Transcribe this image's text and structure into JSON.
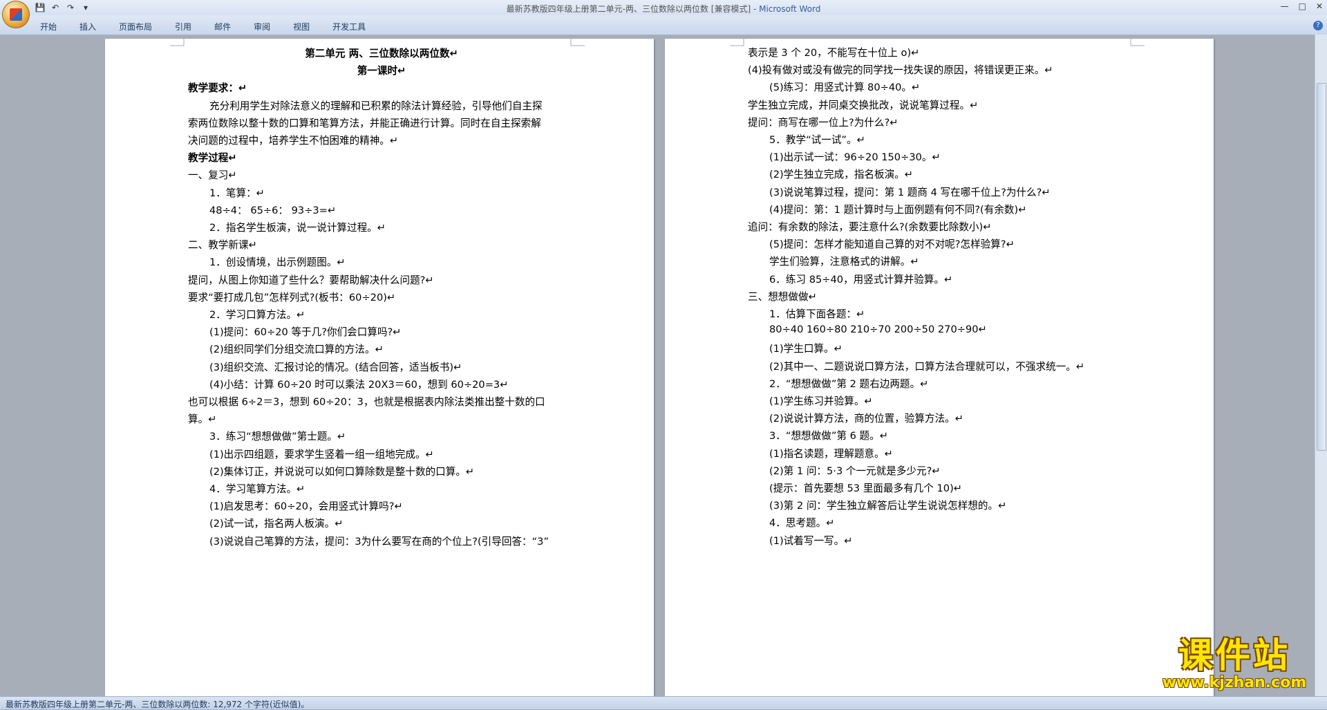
{
  "window": {
    "title": "最新苏教版四年级上册第二单元-两、三位数除以两位数 [兼容模式]",
    "app_suffix": " - Microsoft Word",
    "minimize": "—",
    "maximize": "□",
    "close": "✕"
  },
  "qat": {
    "save": "💾",
    "undo": "↶",
    "redo": "↷",
    "more": "▾"
  },
  "ribbon": {
    "tabs": [
      "开始",
      "插入",
      "页面布局",
      "引用",
      "邮件",
      "审阅",
      "视图",
      "开发工具"
    ],
    "help": "?"
  },
  "left_page": {
    "lines": [
      {
        "text": "第二单元 两、三位数除以两位数↵",
        "bold": true,
        "center": true
      },
      {
        "text": "第一课时↵",
        "bold": true,
        "center": true
      },
      {
        "text": "教学要求：↵",
        "bold": true
      },
      {
        "text": "充分利用学生对除法意义的理解和已积累的除法计算经验，引导他们自主探",
        "indent": true
      },
      {
        "text": "索两位数除以整十数的口算和笔算方法，并能正确进行计算。同时在自主探索解"
      },
      {
        "text": "决问题的过程中，培养学生不怕困难的精神。↵"
      },
      {
        "text": "教学过程↵",
        "bold": true
      },
      {
        "text": "一、复习↵"
      },
      {
        "text": "1．笔算：↵",
        "indent": true
      },
      {
        "text": "48÷4：      65÷6：      93÷3=↵",
        "indent": true
      },
      {
        "text": "2．指名学生板演，说一说计算过程。↵",
        "indent": true
      },
      {
        "text": "二、教学新课↵"
      },
      {
        "text": "1．创设情境，出示例题图。↵",
        "indent": true
      },
      {
        "text": "提问，从图上你知道了些什么？要帮助解决什么问题?↵"
      },
      {
        "text": "要求“要打成几包”怎样列式?(板书：60÷20)↵"
      },
      {
        "text": "2．学习口算方法。↵",
        "indent": true
      },
      {
        "text": "(1)提问：60÷20 等于几?你们会口算吗?↵",
        "indent": true
      },
      {
        "text": "(2)组织同学们分组交流口算的方法。↵",
        "indent": true
      },
      {
        "text": "(3)组织交流、汇报讨论的情况。(结合回答，适当板书)↵",
        "indent": true
      },
      {
        "text": "(4)小结：计算 60÷20 时可以乘法 20X3＝60，想到 60÷20=3↵",
        "indent": true
      },
      {
        "text": "也可以根据 6÷2＝3，想到 60÷20：3，也就是根据表内除法类推出整十数的口"
      },
      {
        "text": "算。↵"
      },
      {
        "text": "3．练习“想想做做”第士题。↵",
        "indent": true
      },
      {
        "text": "(1)出示四组题，要求学生竖着一组一组地完成。↵",
        "indent": true
      },
      {
        "text": "(2)集体订正，并说说可以如何口算除数是整十数的口算。↵",
        "indent": true
      },
      {
        "text": "4．学习笔算方法。↵",
        "indent": true
      },
      {
        "text": "(1)启发思考：60÷20，会用竖式计算吗?↵",
        "indent": true
      },
      {
        "text": "(2)试一试，指名两人板演。↵",
        "indent": true
      },
      {
        "text": "(3)说说自己笔算的方法，提问：3为什么要写在商的个位上?(引导回答：“3”",
        "indent": true
      }
    ]
  },
  "right_page": {
    "lines": [
      {
        "text": "表示是 3 个 20，不能写在十位上 o)↵"
      },
      {
        "text": "(4)投有做对或没有做完的同学找一找失误的原因，将错误更正来。↵"
      },
      {
        "text": "(5)练习：用竖式计算 80÷40。↵",
        "indent": true
      },
      {
        "text": "学生独立完成，并同桌交换批改，说说笔算过程。↵"
      },
      {
        "text": "提问：商写在哪一位上?为什么?↵"
      },
      {
        "text": "5．教学“试一试”。↵",
        "indent": true
      },
      {
        "text": "(1)出示试一试：96÷20   150÷30。↵",
        "indent": true
      },
      {
        "text": "(2)学生独立完成，指名板演。↵",
        "indent": true
      },
      {
        "text": "(3)说说笔算过程，提问：第 1 题商 4 写在哪千位上?为什么?↵",
        "indent": true
      },
      {
        "text": "(4)提问：第：1 题计算时与上面例题有何不同?(有余数)↵",
        "indent": true
      },
      {
        "text": "追问：有余数的除法，要注意什么?(余数要比除数小)↵"
      },
      {
        "text": "(5)提问：怎样才能知道自己算的对不对呢?怎样验算?↵",
        "indent": true
      },
      {
        "text": "学生们验算，注意格式的讲解。↵",
        "indent": true
      },
      {
        "text": "6．练习 85÷40，用竖式计算并验算。↵",
        "indent": true
      },
      {
        "text": "三、想想做做↵"
      },
      {
        "text": "1．估算下面各题：↵",
        "indent": true
      },
      {
        "text": "80÷40     160÷80     210÷70     200÷50     270÷90↵",
        "indent": true
      },
      {
        "text": "(1)学生口算。↵",
        "indent": true
      },
      {
        "text": "(2)其中一、二题说说口算方法，口算方法合理就可以，不强求统一。↵",
        "indent": true
      },
      {
        "text": "2．“想想做做”第 2 题右边两题。↵",
        "indent": true
      },
      {
        "text": "(1)学生练习并验算。↵",
        "indent": true
      },
      {
        "text": "(2)说说计算方法，商的位置，验算方法。↵",
        "indent": true
      },
      {
        "text": "3．“想想做做”第 6 题。↵",
        "indent": true
      },
      {
        "text": "(1)指名读题，理解题意。↵",
        "indent": true
      },
      {
        "text": "(2)第 1 问：5·3 个一元就是多少元?↵",
        "indent": true
      },
      {
        "text": "(提示：首先要想 53 里面最多有几个 10)↵",
        "indent": true
      },
      {
        "text": "(3)第 2 问：学生独立解答后让学生说说怎样想的。↵",
        "indent": true
      },
      {
        "text": "4．思考题。↵",
        "indent": true
      },
      {
        "text": "(1)试着写一写。↵",
        "indent": true
      }
    ]
  },
  "status_bar": {
    "text": "最新苏教版四年级上册第二单元-两、三位数除以两位数: 12,972 个字符(近似值)。"
  },
  "watermark": {
    "main": "课件站",
    "url": "www.kjzhan.com"
  }
}
